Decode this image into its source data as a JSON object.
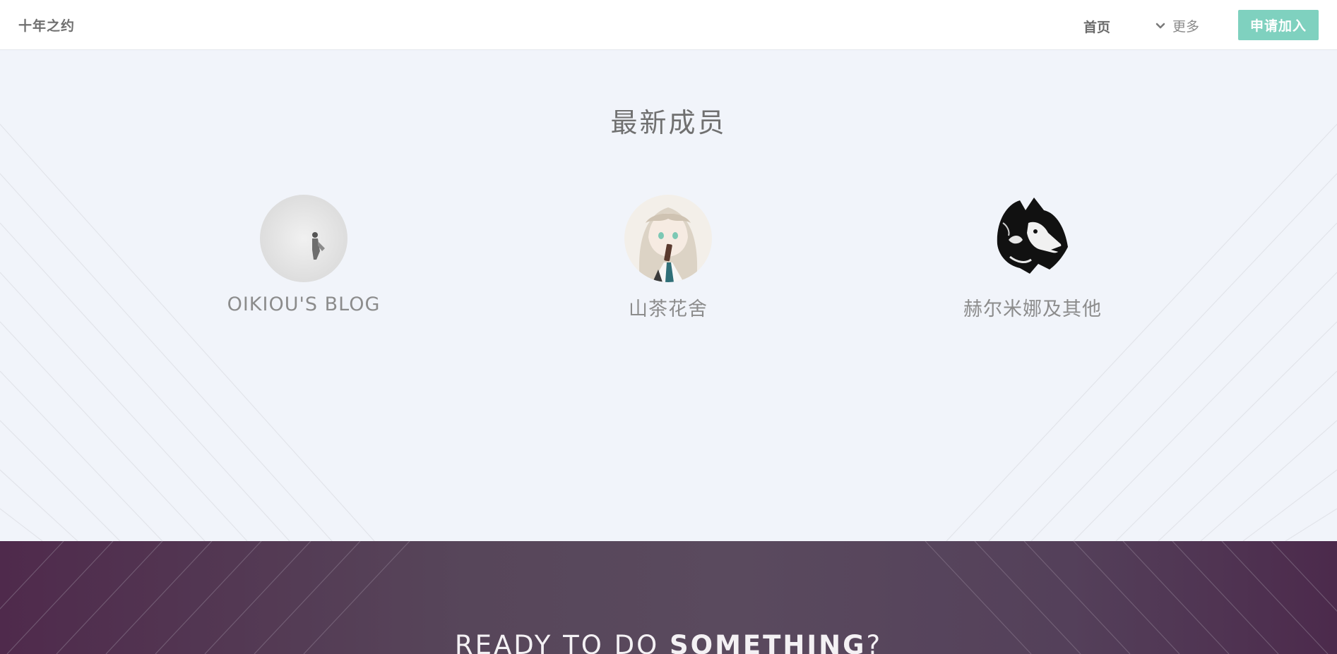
{
  "header": {
    "brand": "十年之约",
    "nav_home": "首页",
    "nav_more": "更多",
    "join_button": "申请加入"
  },
  "members_section": {
    "title": "最新成员",
    "members": [
      {
        "name": "OIKIOU'S BLOG",
        "avatar": "misty-figure-avatar"
      },
      {
        "name": "山茶花舍",
        "avatar": "anime-girl-avatar"
      },
      {
        "name": "赫尔米娜及其他",
        "avatar": "wolf-avatar"
      }
    ]
  },
  "cta": {
    "text_part1": "READY TO DO ",
    "text_strong": "SOMETHING",
    "text_part2": "?"
  },
  "colors": {
    "accent": "#7fd1bf",
    "page_background": "#f1f4fa",
    "cta_background": "#57465a"
  }
}
